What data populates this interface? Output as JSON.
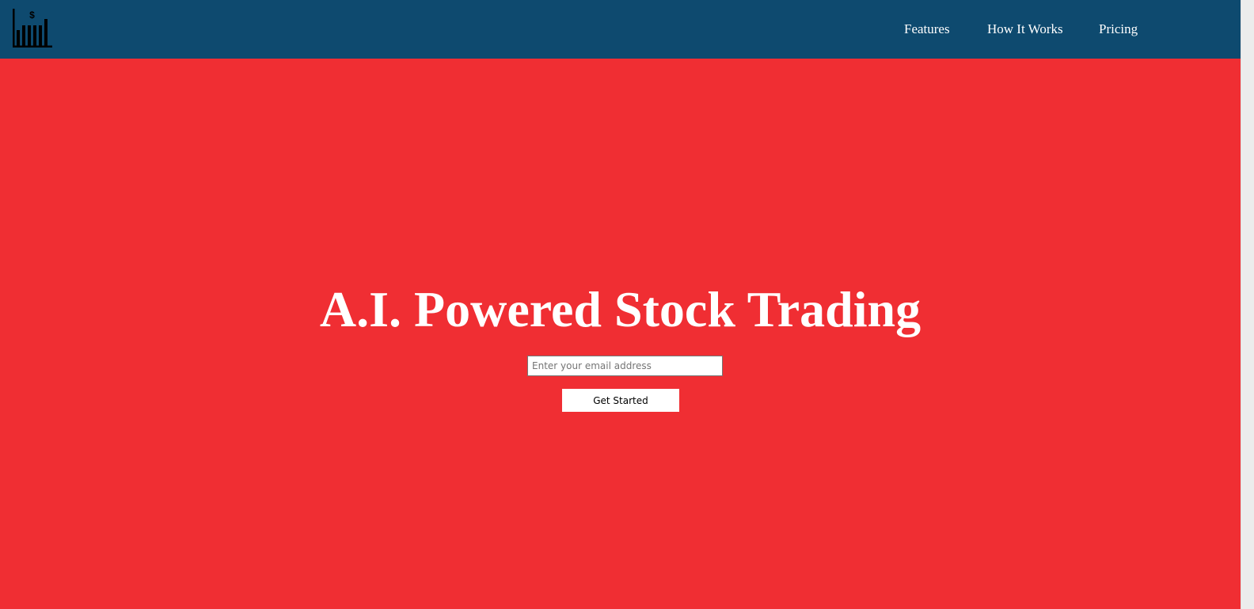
{
  "header": {
    "logo_symbol": "$",
    "logo_icon": "bar-chart-dollar-icon",
    "background_color": "#0e4a6f"
  },
  "nav": {
    "items": [
      {
        "label": "Features"
      },
      {
        "label": "How It Works"
      },
      {
        "label": "Pricing"
      }
    ]
  },
  "hero": {
    "title": "A.I. Powered Stock Trading",
    "background_color": "#f02e33",
    "email_placeholder": "Enter your email address",
    "email_value": "",
    "cta_label": "Get Started"
  }
}
